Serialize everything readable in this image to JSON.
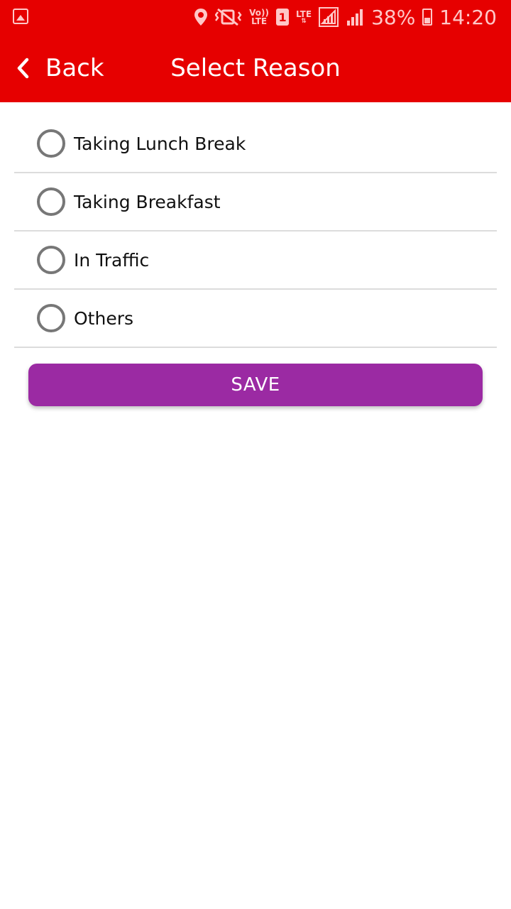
{
  "status_bar": {
    "volte_label_top": "Vo))",
    "volte_label_bottom": "LTE",
    "sim_label": "1",
    "lte_label": "LTE",
    "battery_percent": "38%",
    "time": "14:20"
  },
  "header": {
    "back_label": "Back",
    "title": "Select Reason",
    "color": "#e60000"
  },
  "reasons": [
    {
      "label": "Taking Lunch Break",
      "selected": false
    },
    {
      "label": "Taking Breakfast",
      "selected": false
    },
    {
      "label": "In Traffic",
      "selected": false
    },
    {
      "label": "Others",
      "selected": false
    }
  ],
  "save_button": {
    "label": "SAVE",
    "color": "#9b2aa3"
  }
}
